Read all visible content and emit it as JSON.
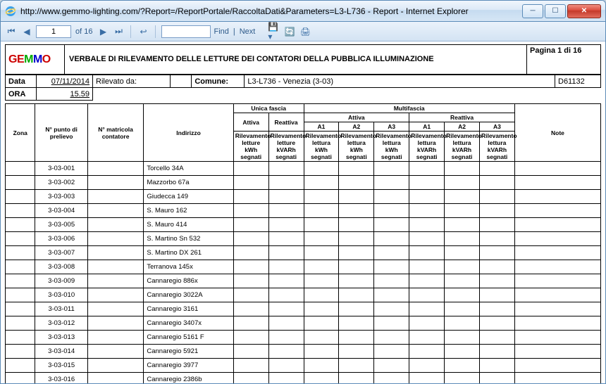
{
  "window": {
    "url": "http://www.gemmo-lighting.com/?Report=/ReportPortale/RaccoltaDati&Parameters=L3-L736 - Report - Internet Explorer"
  },
  "toolbar": {
    "current_page": "1",
    "total_pages_label": "of 16",
    "find_input": "",
    "find_label": "Find",
    "next_label": "Next"
  },
  "report": {
    "logo_text": "GEMMO",
    "title": "VERBALE DI RILEVAMENTO DELLE LETTURE DEI CONTATORI DELLA PUBBLICA ILLUMINAZIONE",
    "page_label": "Pagina 1 di 16",
    "data_label": "Data",
    "data_value": "07/11/2014",
    "ora_label": "ORA",
    "ora_value": "15.59",
    "rilevato_label": "Rilevato da:",
    "comune_label": "Comune:",
    "comune_value": "L3-L736 - Venezia (3-03)",
    "code": "D61132"
  },
  "headers": {
    "zona": "Zona",
    "punto": "N° punto di prelievo",
    "matricola": "N° matricola contatore",
    "indirizzo": "Indirizzo",
    "unica_fascia": "Unica fascia",
    "multifascia": "Multifascia",
    "attiva": "Attiva",
    "reattiva": "Reattiva",
    "a1": "A1",
    "a2": "A2",
    "a3": "A3",
    "ril_kwh": "Rilevamento letture kWh segnati",
    "ril_kvarh": "Rilevamento letture kVARh segnati",
    "ril_lettura_kwh": "Rilevamento lettura kWh segnati",
    "ril_lettura_kvarh": "Rilevamento lettura kVARh segnati",
    "note": "Note"
  },
  "rows": [
    {
      "punto": "3-03-001",
      "indirizzo": "Torcello 34A"
    },
    {
      "punto": "3-03-002",
      "indirizzo": "Mazzorbo 67a"
    },
    {
      "punto": "3-03-003",
      "indirizzo": "Giudecca 149"
    },
    {
      "punto": "3-03-004",
      "indirizzo": "S. Mauro 162"
    },
    {
      "punto": "3-03-005",
      "indirizzo": "S. Mauro 414"
    },
    {
      "punto": "3-03-006",
      "indirizzo": "S. Martino Sn 532"
    },
    {
      "punto": "3-03-007",
      "indirizzo": "S. Martino DX 261"
    },
    {
      "punto": "3-03-008",
      "indirizzo": "Terranova 145x"
    },
    {
      "punto": "3-03-009",
      "indirizzo": "Cannaregio 886x"
    },
    {
      "punto": "3-03-010",
      "indirizzo": "Cannaregio 3022A"
    },
    {
      "punto": "3-03-011",
      "indirizzo": "Cannaregio 3161"
    },
    {
      "punto": "3-03-012",
      "indirizzo": "Cannaregio 3407x"
    },
    {
      "punto": "3-03-013",
      "indirizzo": "Cannaregio 5161 F"
    },
    {
      "punto": "3-03-014",
      "indirizzo": "Cannaregio 5921"
    },
    {
      "punto": "3-03-015",
      "indirizzo": "Cannaregio 3977"
    },
    {
      "punto": "3-03-016",
      "indirizzo": "Cannaregio 2386b"
    }
  ]
}
